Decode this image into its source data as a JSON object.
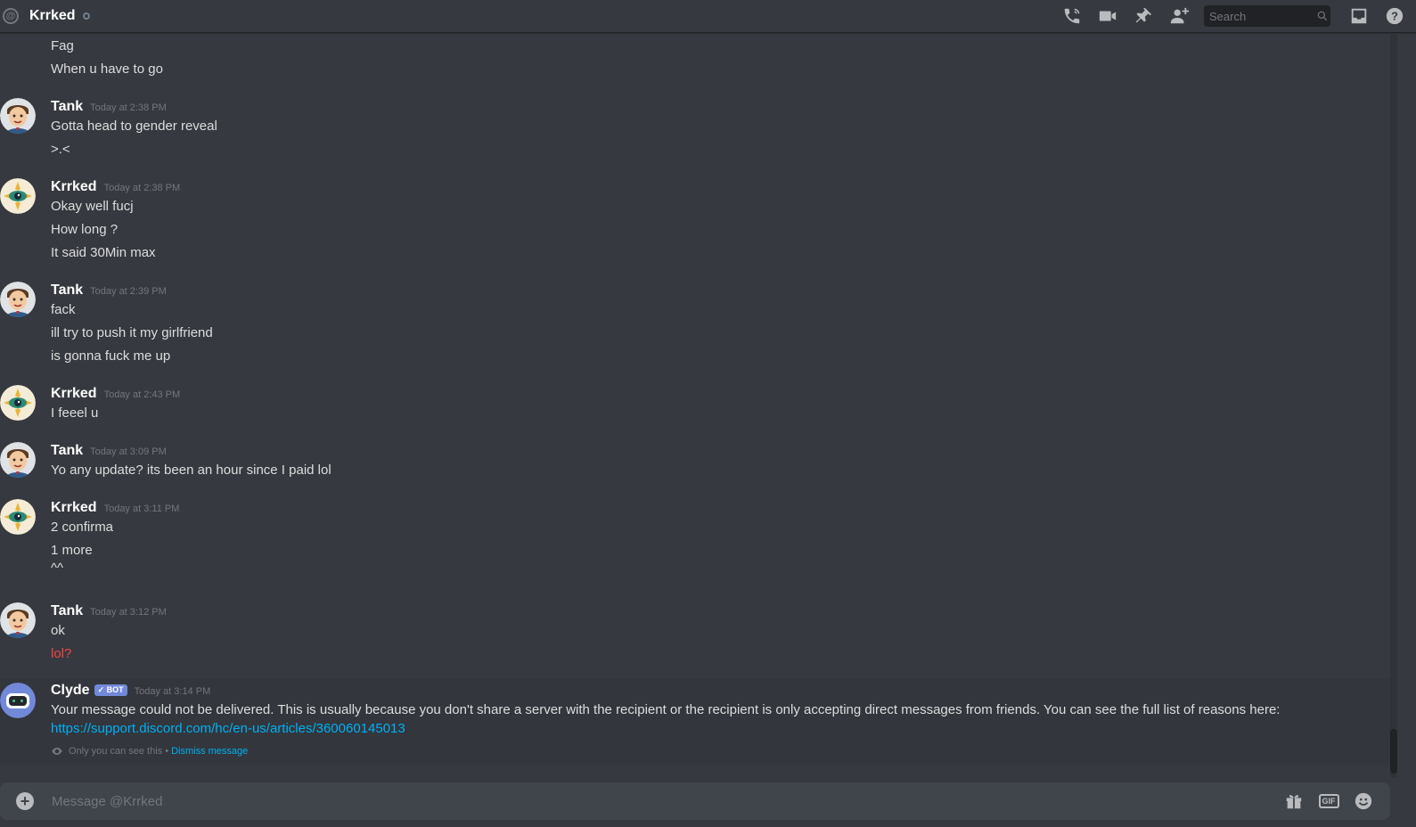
{
  "header": {
    "channel_name": "Krrked",
    "icons": [
      "at-icon",
      "status-idle-icon",
      "start-voice-call-icon",
      "start-video-call-icon",
      "pinned-messages-icon",
      "add-friends-to-dm-icon",
      "inbox-icon",
      "help-icon"
    ]
  },
  "search": {
    "placeholder": "Search"
  },
  "messages": {
    "orphan_lines": [
      "Fag",
      "When u have to go"
    ],
    "groups": [
      {
        "author": "Tank",
        "timestamp": "Today at 2:38 PM",
        "lines": [
          "Gotta head to gender reveal",
          ">.<"
        ]
      },
      {
        "author": "Krrked",
        "timestamp": "Today at 2:38 PM",
        "lines": [
          "Okay well fucj",
          "How long ?",
          "It said 30Min max"
        ]
      },
      {
        "author": "Tank",
        "timestamp": "Today at 2:39 PM",
        "lines": [
          "fack",
          "ill try to push it my girlfriend",
          "is gonna fuck me up"
        ]
      },
      {
        "author": "Krrked",
        "timestamp": "Today at 2:43 PM",
        "lines": [
          "I feeel u"
        ]
      },
      {
        "author": "Tank",
        "timestamp": "Today at 3:09 PM",
        "lines": [
          "Yo any update? its been an hour since I paid lol"
        ]
      },
      {
        "author": "Krrked",
        "timestamp": "Today at 3:11 PM",
        "lines": [
          "2 confirma",
          "1 more",
          "^^"
        ]
      },
      {
        "author": "Tank",
        "timestamp": "Today at 3:12 PM",
        "lines": [
          "ok",
          "lol?"
        ],
        "failed_line_color": "#f04747"
      }
    ],
    "system": {
      "author": "Clyde",
      "bot_tag": "✓ BOT",
      "timestamp": "Today at 3:14 PM",
      "text": "Your message could not be delivered. This is usually because you don't share a server with the recipient or the recipient is only accepting direct messages from friends. You can see the full list of reasons here:",
      "link": "https://support.discord.com/hc/en-us/articles/360060145013",
      "ephemeral_note": "Only you can see this •",
      "dismiss_label": "Dismiss message"
    }
  },
  "composer": {
    "placeholder": "Message @Krrked",
    "gif_label": "GIF",
    "icons": [
      "attach-plus-icon",
      "gift-icon",
      "gif-icon",
      "emoji-icon"
    ]
  },
  "colors": {
    "background": "#36393f",
    "link": "#00b0f4",
    "bot_tag": "#7289da",
    "failed_message": "#f04747"
  }
}
